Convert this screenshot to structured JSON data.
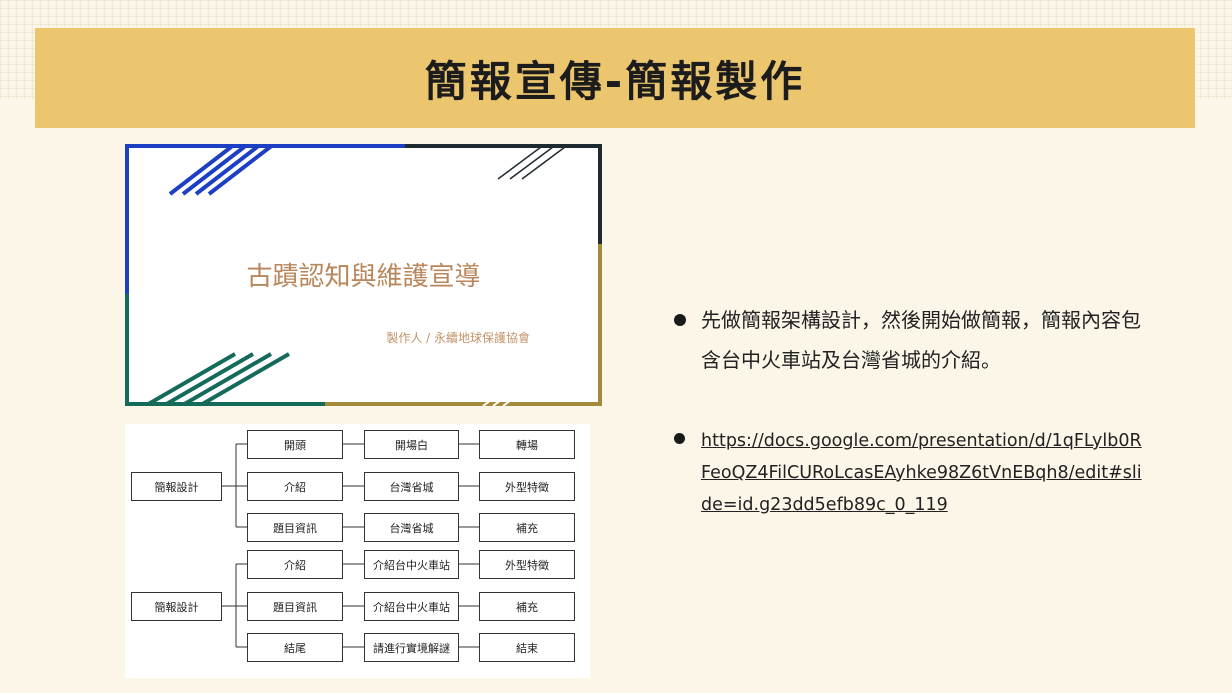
{
  "header": {
    "title": "簡報宣傳-簡報製作"
  },
  "slide_thumbnail": {
    "title": "古蹟認知與維護宣導",
    "subtitle": "製作人 / 永續地球保護協會"
  },
  "flowchart": {
    "group1": {
      "root": "簡報設計",
      "rows": [
        [
          "開頭",
          "開場白",
          "轉場"
        ],
        [
          "介紹",
          "台灣省城",
          "外型特徵"
        ],
        [
          "題目資訊",
          "台灣省城",
          "補充"
        ]
      ]
    },
    "group2": {
      "root": "簡報設計",
      "rows": [
        [
          "介紹",
          "介紹台中火車站",
          "外型特徵"
        ],
        [
          "題目資訊",
          "介紹台中火車站",
          "補充"
        ],
        [
          "結尾",
          "請進行實境解謎",
          "結束"
        ]
      ]
    }
  },
  "bullets": {
    "item1": "先做簡報架構設計，然後開始做簡報，簡報內容包含台中火車站及台灣省城的介紹。",
    "item2": "https://docs.google.com/presentation/d/1qFLylb0RFeoQZ4FilCURoLcasEAyhke98Z6tVnEBqh8/edit#slide=id.g23dd5efb89c_0_119"
  },
  "colors": {
    "title_bar": "#ecc66f",
    "background": "#fbf6e8",
    "thumb_title": "#b8865a"
  }
}
